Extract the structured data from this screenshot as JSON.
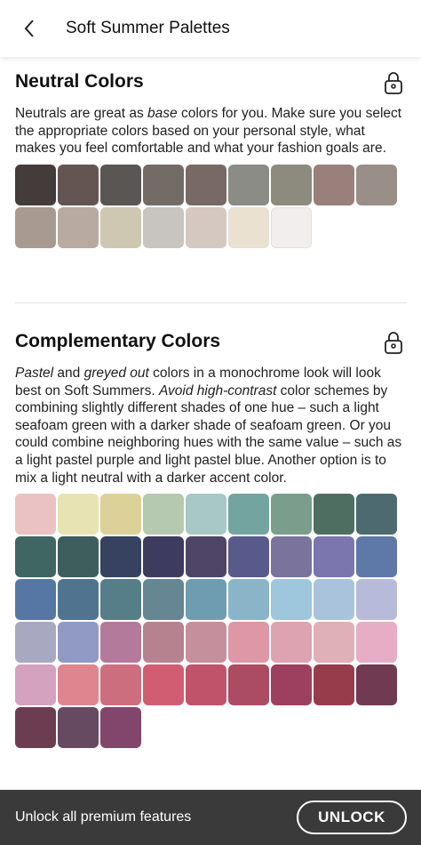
{
  "header": {
    "title": "Soft Summer Palettes",
    "back_icon": "chevron-left-icon"
  },
  "neutral": {
    "title": "Neutral Colors",
    "lock_icon": "padlock-icon",
    "description": [
      {
        "t": "Neutrals are great as ",
        "i": false
      },
      {
        "t": "base",
        "i": true
      },
      {
        "t": " colors for you. Make sure you select the appropriate colors based on your personal style, what makes you feel comfortable and what your fashion goals are.",
        "i": false
      }
    ],
    "swatches": [
      "#433c3a",
      "#655552",
      "#5a5653",
      "#736b66",
      "#786964",
      "#8a8c85",
      "#8c8b7d",
      "#9a807a",
      "#9a8e88",
      "#a89a91",
      "#b8aaa1",
      "#cec8b2",
      "#c8c5c0",
      "#d5c8c0",
      "#ebe1d0",
      "#f3eeee"
    ]
  },
  "complementary": {
    "title": "Complementary Colors",
    "lock_icon": "padlock-icon",
    "description": [
      {
        "t": "Pastel",
        "i": true
      },
      {
        "t": " and ",
        "i": false
      },
      {
        "t": "greyed out",
        "i": true
      },
      {
        "t": " colors in a monochrome look will look best on Soft Summers. ",
        "i": false
      },
      {
        "t": "Avoid high-contrast",
        "i": true
      },
      {
        "t": " color schemes by combining slightly different shades of one hue – such a light seafoam green with a darker shade of seafoam green. Or you could combine neighboring hues with the same value – such as a light pastel purple and light pastel blue. Another option is to mix a light neutral with a darker accent color.",
        "i": false
      }
    ],
    "swatches": [
      "#eac2c3",
      "#e8e3b2",
      "#ddd19a",
      "#b5c9b0",
      "#a8c8c5",
      "#74a4a0",
      "#7a9e8b",
      "#4f6e62",
      "#4d6a70",
      "#3f6662",
      "#3e5e5d",
      "#36425f",
      "#3d3c5f",
      "#4f4567",
      "#585a8c",
      "#7a749c",
      "#7b76ae",
      "#5e78a8",
      "#5677a4",
      "#50738f",
      "#557e89",
      "#658692",
      "#6e9cb1",
      "#8ab4c8",
      "#9ec6dd",
      "#a9c3dc",
      "#b7bbd9",
      "#a8a8c0",
      "#909ac4",
      "#b37a9b",
      "#b7828f",
      "#c58f9b",
      "#dd97a6",
      "#dea3b1",
      "#dfb0b7",
      "#e7adc5",
      "#d4a1bf",
      "#df8590",
      "#cd6e7e",
      "#d15d73",
      "#c0536a",
      "#ac4c62",
      "#9d3f5e",
      "#973c4b",
      "#713a53",
      "#6c3d51",
      "#654a61",
      "#82466c"
    ]
  },
  "bottom_bar": {
    "text": "Unlock all premium features",
    "button": "UNLOCK"
  }
}
